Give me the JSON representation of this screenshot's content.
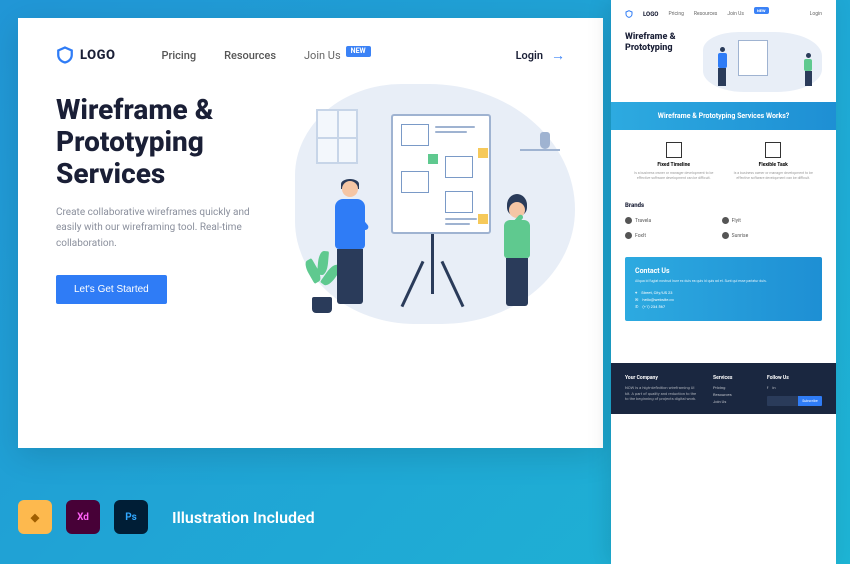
{
  "nav": {
    "logo_text": "LOGO",
    "items": [
      "Pricing",
      "Resources"
    ],
    "join": "Join Us",
    "join_badge": "NEW",
    "login": "Login"
  },
  "hero": {
    "title": "Wireframe & Prototyping Services",
    "subtitle": "Create collaborative wireframes quickly and easily with our wireframing tool. Real-time collaboration.",
    "cta": "Let's Get Started"
  },
  "preview": {
    "nav": {
      "logo": "LOGO",
      "items": [
        "Pricing",
        "Resources",
        "Join Us"
      ],
      "badge": "NEW",
      "login": "Login"
    },
    "title": "Wireframe & Prototyping",
    "works_title": "Wireframe & Prototyping Services Works?",
    "cards": [
      {
        "title": "Fixed Timeline",
        "desc": "Is a business owner or manager development to be effective software development can be difficult."
      },
      {
        "title": "Flexible Task",
        "desc": "Is a business owner or manager development to be effective software development can be difficult."
      }
    ],
    "brands_title": "Brands",
    "brands": [
      "Travela",
      "Flyit",
      "FoxIt",
      "Sunrise"
    ],
    "contact": {
      "title": "Contact Us",
      "desc": "Aliqua id fugiat nostrud irure ex duis ea quis id quis ad et. Sunt qui esse pariatur duis.",
      "items": [
        "Street, City/US 23",
        "hello@website.co",
        "(+1) 234 567"
      ]
    },
    "footer": {
      "company_t": "Your Company",
      "company_d": "NOW is a high-definition wireframing UI kit. A part of quality and reduction to the to the beginning of projects digital work.",
      "services_t": "Services",
      "services": [
        "Pricing",
        "Resources",
        "Join Us"
      ],
      "follow_t": "Follow Us",
      "subscribe_btn": "Subscribe"
    }
  },
  "bottom": {
    "tools": {
      "sketch": "◆",
      "xd": "Xd",
      "ps": "Ps"
    },
    "text": "Illustration Included"
  }
}
